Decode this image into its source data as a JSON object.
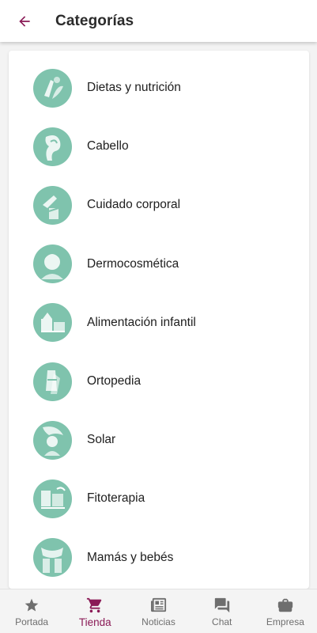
{
  "header": {
    "title": "Categorías",
    "back_icon": "arrow-left-icon"
  },
  "colors": {
    "accent": "#8a1a56",
    "thumb_bg": "#7fc3ad",
    "inactive": "#6e6e6e"
  },
  "categories": [
    {
      "label": "Dietas y nutrición",
      "icon": "salad-image"
    },
    {
      "label": "Cabello",
      "icon": "hair-image"
    },
    {
      "label": "Cuidado corporal",
      "icon": "body-care-image"
    },
    {
      "label": "Dermocosmética",
      "icon": "face-image"
    },
    {
      "label": "Alimentación infantil",
      "icon": "baby-food-image"
    },
    {
      "label": "Ortopedia",
      "icon": "orthopedics-image"
    },
    {
      "label": "Solar",
      "icon": "sun-image"
    },
    {
      "label": "Fitoterapia",
      "icon": "herbs-image"
    },
    {
      "label": "Mamás y bebés",
      "icon": "mother-baby-image"
    }
  ],
  "bottom_nav": [
    {
      "label": "Portada",
      "icon": "star-icon",
      "active": false
    },
    {
      "label": "Tienda",
      "icon": "cart-icon",
      "active": true
    },
    {
      "label": "Noticias",
      "icon": "newspaper-icon",
      "active": false
    },
    {
      "label": "Chat",
      "icon": "chat-icon",
      "active": false
    },
    {
      "label": "Empresa",
      "icon": "briefcase-icon",
      "active": false
    }
  ]
}
